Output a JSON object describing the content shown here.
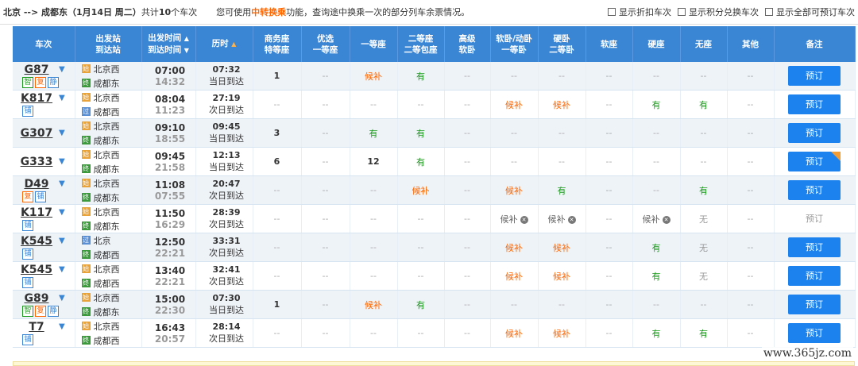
{
  "topbar": {
    "route": "北京 --> 成都东（1月14日 周二）",
    "count_prefix": "共计",
    "count": "10",
    "count_suffix": "个车次",
    "tip_prefix": "您可使用",
    "tip_highlight": "中转换乘",
    "tip_suffix": "功能，查询途中换乘一次的部分列车余票情况。",
    "filters": [
      "显示折扣车次",
      "显示积分兑换车次",
      "显示全部可预订车次"
    ]
  },
  "header": {
    "train": "车次",
    "station_1": "出发站",
    "station_2": "到达站",
    "time_1": "出发时间",
    "time_2": "到达时间",
    "duration": "历时",
    "c1a": "商务座",
    "c1b": "特等座",
    "c2a": "优选",
    "c2b": "一等座",
    "c3": "一等座",
    "c4a": "二等座",
    "c4b": "二等包座",
    "c5a": "高级",
    "c5b": "软卧",
    "c6a": "软卧/动卧",
    "c6b": "一等卧",
    "c7a": "硬卧",
    "c7b": "二等卧",
    "c8": "软座",
    "c9": "硬座",
    "c10": "无座",
    "c11": "其他",
    "remark": "备注"
  },
  "rows": [
    {
      "train": "G87",
      "tags": [
        {
          "t": "智",
          "k": "zhi"
        },
        {
          "t": "复",
          "k": "fu"
        },
        {
          "t": "静",
          "k": "jing"
        }
      ],
      "from": "北京西",
      "from_icon": "始",
      "to": "成都东",
      "to_icon": "终",
      "dep": "07:00",
      "arr": "14:32",
      "dur": "07:32",
      "day": "当日到达",
      "seats": [
        {
          "v": "1",
          "k": "num"
        },
        {
          "v": "--",
          "k": "na"
        },
        {
          "v": "候补",
          "k": "hb"
        },
        {
          "v": "有",
          "k": "you"
        },
        {
          "v": "--",
          "k": "na"
        },
        {
          "v": "--",
          "k": "na"
        },
        {
          "v": "--",
          "k": "na"
        },
        {
          "v": "--",
          "k": "na"
        },
        {
          "v": "--",
          "k": "na"
        },
        {
          "v": "--",
          "k": "na"
        },
        {
          "v": "--",
          "k": "na"
        }
      ],
      "btn": "预订",
      "btn_k": "on",
      "corner": false
    },
    {
      "train": "K817",
      "tags": [
        {
          "t": "铺",
          "k": "pu"
        }
      ],
      "from": "北京西",
      "from_icon": "始",
      "to": "成都西",
      "to_icon": "过",
      "dep": "08:04",
      "arr": "11:23",
      "dur": "27:19",
      "day": "次日到达",
      "seats": [
        {
          "v": "--",
          "k": "na"
        },
        {
          "v": "--",
          "k": "na"
        },
        {
          "v": "--",
          "k": "na"
        },
        {
          "v": "--",
          "k": "na"
        },
        {
          "v": "--",
          "k": "na"
        },
        {
          "v": "候补",
          "k": "hb"
        },
        {
          "v": "候补",
          "k": "hb"
        },
        {
          "v": "--",
          "k": "na"
        },
        {
          "v": "有",
          "k": "you"
        },
        {
          "v": "有",
          "k": "you"
        },
        {
          "v": "--",
          "k": "na"
        }
      ],
      "btn": "预订",
      "btn_k": "on",
      "corner": false
    },
    {
      "train": "G307",
      "tags": [],
      "from": "北京西",
      "from_icon": "始",
      "to": "成都东",
      "to_icon": "终",
      "dep": "09:10",
      "arr": "18:55",
      "dur": "09:45",
      "day": "当日到达",
      "seats": [
        {
          "v": "3",
          "k": "num"
        },
        {
          "v": "--",
          "k": "na"
        },
        {
          "v": "有",
          "k": "you"
        },
        {
          "v": "有",
          "k": "you"
        },
        {
          "v": "--",
          "k": "na"
        },
        {
          "v": "--",
          "k": "na"
        },
        {
          "v": "--",
          "k": "na"
        },
        {
          "v": "--",
          "k": "na"
        },
        {
          "v": "--",
          "k": "na"
        },
        {
          "v": "--",
          "k": "na"
        },
        {
          "v": "--",
          "k": "na"
        }
      ],
      "btn": "预订",
      "btn_k": "on",
      "corner": false
    },
    {
      "train": "G333",
      "tags": [],
      "from": "北京西",
      "from_icon": "始",
      "to": "成都东",
      "to_icon": "终",
      "dep": "09:45",
      "arr": "21:58",
      "dur": "12:13",
      "day": "当日到达",
      "seats": [
        {
          "v": "6",
          "k": "num"
        },
        {
          "v": "--",
          "k": "na"
        },
        {
          "v": "12",
          "k": "num"
        },
        {
          "v": "有",
          "k": "you"
        },
        {
          "v": "--",
          "k": "na"
        },
        {
          "v": "--",
          "k": "na"
        },
        {
          "v": "--",
          "k": "na"
        },
        {
          "v": "--",
          "k": "na"
        },
        {
          "v": "--",
          "k": "na"
        },
        {
          "v": "--",
          "k": "na"
        },
        {
          "v": "--",
          "k": "na"
        }
      ],
      "btn": "预订",
      "btn_k": "on",
      "corner": true
    },
    {
      "train": "D49",
      "tags": [
        {
          "t": "复",
          "k": "fu"
        },
        {
          "t": "铺",
          "k": "pu"
        }
      ],
      "from": "北京西",
      "from_icon": "始",
      "to": "成都东",
      "to_icon": "终",
      "dep": "11:08",
      "arr": "07:55",
      "dur": "20:47",
      "day": "次日到达",
      "seats": [
        {
          "v": "--",
          "k": "na"
        },
        {
          "v": "--",
          "k": "na"
        },
        {
          "v": "--",
          "k": "na"
        },
        {
          "v": "候补",
          "k": "hb"
        },
        {
          "v": "--",
          "k": "na"
        },
        {
          "v": "候补",
          "k": "hb"
        },
        {
          "v": "有",
          "k": "you"
        },
        {
          "v": "--",
          "k": "na"
        },
        {
          "v": "--",
          "k": "na"
        },
        {
          "v": "有",
          "k": "you"
        },
        {
          "v": "--",
          "k": "na"
        }
      ],
      "btn": "预订",
      "btn_k": "on",
      "corner": false
    },
    {
      "train": "K117",
      "tags": [
        {
          "t": "铺",
          "k": "pu"
        }
      ],
      "from": "北京西",
      "from_icon": "始",
      "to": "成都东",
      "to_icon": "终",
      "dep": "11:50",
      "arr": "16:29",
      "dur": "28:39",
      "day": "次日到达",
      "seats": [
        {
          "v": "--",
          "k": "na"
        },
        {
          "v": "--",
          "k": "na"
        },
        {
          "v": "--",
          "k": "na"
        },
        {
          "v": "--",
          "k": "na"
        },
        {
          "v": "--",
          "k": "na"
        },
        {
          "v": "候补",
          "k": "hbx"
        },
        {
          "v": "候补",
          "k": "hbx"
        },
        {
          "v": "--",
          "k": "na"
        },
        {
          "v": "候补",
          "k": "hbx"
        },
        {
          "v": "无",
          "k": "wu"
        },
        {
          "v": "--",
          "k": "na"
        }
      ],
      "btn": "预订",
      "btn_k": "off",
      "corner": false
    },
    {
      "train": "K545",
      "tags": [
        {
          "t": "铺",
          "k": "pu"
        }
      ],
      "from": "北京",
      "from_icon": "过",
      "to": "成都西",
      "to_icon": "终",
      "dep": "12:50",
      "arr": "22:21",
      "dur": "33:31",
      "day": "次日到达",
      "seats": [
        {
          "v": "--",
          "k": "na"
        },
        {
          "v": "--",
          "k": "na"
        },
        {
          "v": "--",
          "k": "na"
        },
        {
          "v": "--",
          "k": "na"
        },
        {
          "v": "--",
          "k": "na"
        },
        {
          "v": "候补",
          "k": "hb"
        },
        {
          "v": "候补",
          "k": "hb"
        },
        {
          "v": "--",
          "k": "na"
        },
        {
          "v": "有",
          "k": "you"
        },
        {
          "v": "无",
          "k": "wu"
        },
        {
          "v": "--",
          "k": "na"
        }
      ],
      "btn": "预订",
      "btn_k": "on",
      "corner": false
    },
    {
      "train": "K545",
      "tags": [
        {
          "t": "铺",
          "k": "pu"
        }
      ],
      "from": "北京西",
      "from_icon": "始",
      "to": "成都西",
      "to_icon": "终",
      "dep": "13:40",
      "arr": "22:21",
      "dur": "32:41",
      "day": "次日到达",
      "seats": [
        {
          "v": "--",
          "k": "na"
        },
        {
          "v": "--",
          "k": "na"
        },
        {
          "v": "--",
          "k": "na"
        },
        {
          "v": "--",
          "k": "na"
        },
        {
          "v": "--",
          "k": "na"
        },
        {
          "v": "候补",
          "k": "hb"
        },
        {
          "v": "候补",
          "k": "hb"
        },
        {
          "v": "--",
          "k": "na"
        },
        {
          "v": "有",
          "k": "you"
        },
        {
          "v": "无",
          "k": "wu"
        },
        {
          "v": "--",
          "k": "na"
        }
      ],
      "btn": "预订",
      "btn_k": "on",
      "corner": false
    },
    {
      "train": "G89",
      "tags": [
        {
          "t": "智",
          "k": "zhi"
        },
        {
          "t": "复",
          "k": "fu"
        },
        {
          "t": "静",
          "k": "jing"
        }
      ],
      "from": "北京西",
      "from_icon": "始",
      "to": "成都东",
      "to_icon": "终",
      "dep": "15:00",
      "arr": "22:30",
      "dur": "07:30",
      "day": "当日到达",
      "seats": [
        {
          "v": "1",
          "k": "num"
        },
        {
          "v": "--",
          "k": "na"
        },
        {
          "v": "候补",
          "k": "hb"
        },
        {
          "v": "有",
          "k": "you"
        },
        {
          "v": "--",
          "k": "na"
        },
        {
          "v": "--",
          "k": "na"
        },
        {
          "v": "--",
          "k": "na"
        },
        {
          "v": "--",
          "k": "na"
        },
        {
          "v": "--",
          "k": "na"
        },
        {
          "v": "--",
          "k": "na"
        },
        {
          "v": "--",
          "k": "na"
        }
      ],
      "btn": "预订",
      "btn_k": "on",
      "corner": false
    },
    {
      "train": "T7",
      "tags": [
        {
          "t": "铺",
          "k": "pu"
        }
      ],
      "from": "北京西",
      "from_icon": "始",
      "to": "成都西",
      "to_icon": "终",
      "dep": "16:43",
      "arr": "20:57",
      "dur": "28:14",
      "day": "次日到达",
      "seats": [
        {
          "v": "--",
          "k": "na"
        },
        {
          "v": "--",
          "k": "na"
        },
        {
          "v": "--",
          "k": "na"
        },
        {
          "v": "--",
          "k": "na"
        },
        {
          "v": "--",
          "k": "na"
        },
        {
          "v": "候补",
          "k": "hb"
        },
        {
          "v": "候补",
          "k": "hb"
        },
        {
          "v": "--",
          "k": "na"
        },
        {
          "v": "有",
          "k": "you"
        },
        {
          "v": "有",
          "k": "you"
        },
        {
          "v": "--",
          "k": "na"
        }
      ],
      "btn": "预订",
      "btn_k": "on",
      "corner": false
    }
  ],
  "watermark": "www.365jz.com",
  "colors": {
    "header_bg": "#3b86d4",
    "book_button": "#1b82ee",
    "available": "#1a9a1a",
    "waitlist": "#f60"
  }
}
